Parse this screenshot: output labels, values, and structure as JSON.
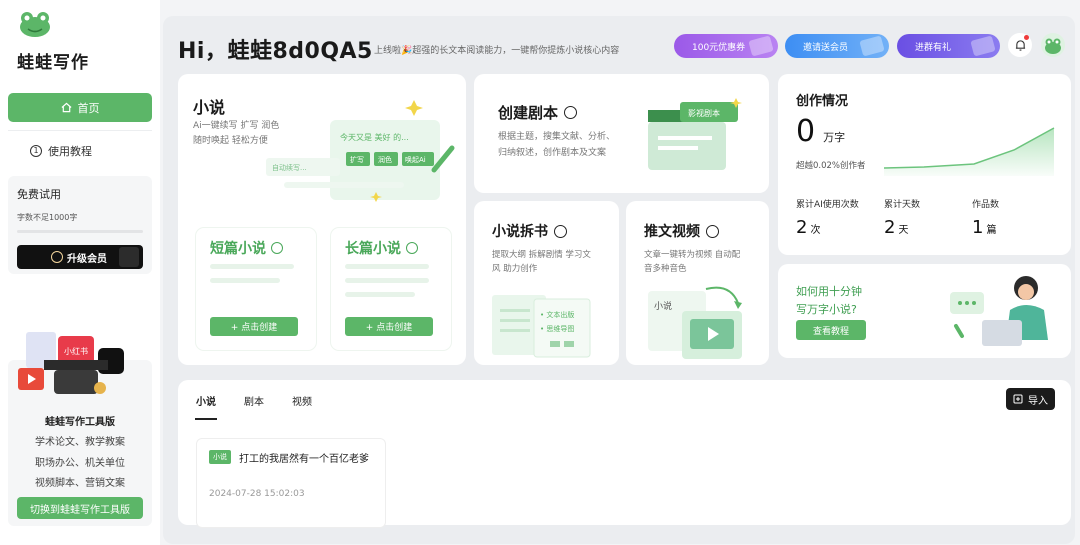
{
  "sidebar": {
    "brand": "蛙蛙写作",
    "nav": {
      "home": "首页",
      "tutorial": "使用教程"
    },
    "trial": {
      "title": "免费试用",
      "subtitle": "字数不足1000字",
      "upgrade": "升级会员"
    },
    "tool": {
      "title": "蛙蛙写作工具版",
      "lines": [
        "学术论文、教学教案",
        "职场办公、机关单位",
        "视频脚本、营销文案"
      ],
      "switch": "切换到蛙蛙写作工具版",
      "illus_badge": "小红书"
    }
  },
  "header": {
    "greeting": "Hi，蛙蛙8d0QA5",
    "marquee": "上线啦🎉超强的长文本阅读能力，一键帮你提炼小说核心内容",
    "promos": [
      "100元优惠券",
      "邀请送会员",
      "进群有礼"
    ]
  },
  "novel": {
    "title": "小说",
    "desc1": "Ai一键续写 扩写 润色",
    "desc2": "随时唤起 轻松方便",
    "illus": {
      "bubble": "今天又是 美好 的...",
      "chip1": "扩写",
      "chip2": "润色",
      "chip3": "唤起Ai",
      "auto": "自动续写..."
    },
    "short": {
      "title": "短篇小说",
      "create": "+ 点击创建"
    },
    "long": {
      "title": "长篇小说",
      "create": "+ 点击创建"
    }
  },
  "script": {
    "title": "创建剧本",
    "desc1": "根据主题，搜集文献、分析、",
    "desc2": "归纳叙述，创作剧本及文案",
    "badge": "影视剧本"
  },
  "split": {
    "title": "小说拆书",
    "desc1": "提取大纲 拆解剧情 学习文",
    "desc2": "风 助力创作",
    "illus1": "• 文本出版",
    "illus2": "• 思维导图"
  },
  "video": {
    "title": "推文视频",
    "desc1": "文章一键转为视频 自动配",
    "desc2": "音多种音色",
    "illus": "小说"
  },
  "stats": {
    "title": "创作情况",
    "words": "0",
    "words_unit": "万字",
    "beat": "超越0.02%创作者",
    "items": [
      {
        "label": "累计AI使用次数",
        "value": "2",
        "unit": "次"
      },
      {
        "label": "累计天数",
        "value": "2",
        "unit": "天"
      },
      {
        "label": "作品数",
        "value": "1",
        "unit": "篇"
      }
    ]
  },
  "tip": {
    "line1": "如何用十分钟",
    "line2": "写万字小说?",
    "button": "查看教程"
  },
  "works": {
    "tabs": [
      "小说",
      "剧本",
      "视频"
    ],
    "import": "导入",
    "item": {
      "tag": "小说",
      "title": "打工的我居然有一个百亿老爹",
      "date": "2024-07-28 15:02:03"
    }
  },
  "colors": {
    "accent": "#5cb668",
    "dark": "#1b1b1b"
  }
}
